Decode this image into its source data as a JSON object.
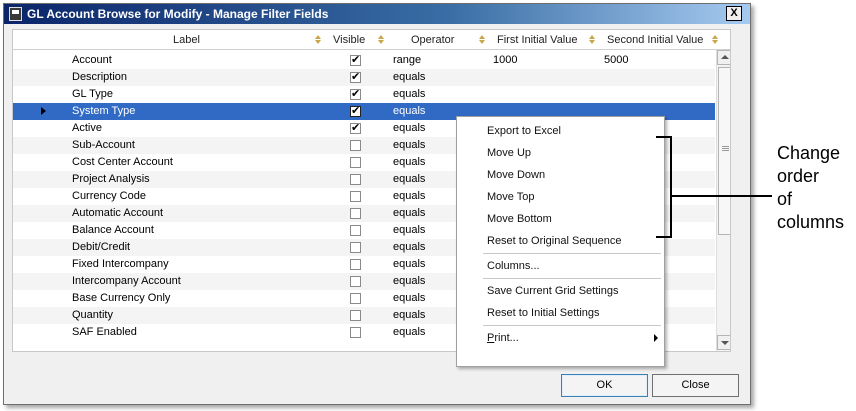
{
  "window": {
    "title": "GL Account Browse for Modify - Manage Filter Fields",
    "close_label": "X",
    "ok_label": "OK",
    "close_button_label": "Close"
  },
  "grid": {
    "columns": [
      "Label",
      "Visible",
      "Operator",
      "First Initial Value",
      "Second Initial Value"
    ],
    "rows": [
      {
        "label": "Account",
        "visible": true,
        "operator": "range",
        "first": "1000",
        "second": "5000"
      },
      {
        "label": "Description",
        "visible": true,
        "operator": "equals",
        "first": "",
        "second": ""
      },
      {
        "label": "GL Type",
        "visible": true,
        "operator": "equals",
        "first": "",
        "second": ""
      },
      {
        "label": "System Type",
        "visible": true,
        "operator": "equals",
        "first": "",
        "second": "",
        "selected": true
      },
      {
        "label": "Active",
        "visible": true,
        "operator": "equals",
        "first": "",
        "second": ""
      },
      {
        "label": "Sub-Account",
        "visible": false,
        "operator": "equals",
        "first": "",
        "second": ""
      },
      {
        "label": "Cost Center Account",
        "visible": false,
        "operator": "equals",
        "first": "",
        "second": ""
      },
      {
        "label": "Project Analysis",
        "visible": false,
        "operator": "equals",
        "first": "",
        "second": ""
      },
      {
        "label": "Currency Code",
        "visible": false,
        "operator": "equals",
        "first": "",
        "second": ""
      },
      {
        "label": "Automatic Account",
        "visible": false,
        "operator": "equals",
        "first": "",
        "second": ""
      },
      {
        "label": "Balance Account",
        "visible": false,
        "operator": "equals",
        "first": "",
        "second": ""
      },
      {
        "label": "Debit/Credit",
        "visible": false,
        "operator": "equals",
        "first": "",
        "second": ""
      },
      {
        "label": "Fixed Intercompany",
        "visible": false,
        "operator": "equals",
        "first": "",
        "second": ""
      },
      {
        "label": "Intercompany Account",
        "visible": false,
        "operator": "equals",
        "first": "",
        "second": ""
      },
      {
        "label": "Base Currency Only",
        "visible": false,
        "operator": "equals",
        "first": "",
        "second": ""
      },
      {
        "label": "Quantity",
        "visible": false,
        "operator": "equals",
        "first": "",
        "second": ""
      },
      {
        "label": "SAF Enabled",
        "visible": false,
        "operator": "equals",
        "first": "",
        "second": ""
      }
    ]
  },
  "context_menu": {
    "items": [
      {
        "label": "Export to Excel"
      },
      {
        "label": "Move Up"
      },
      {
        "label": "Move Down"
      },
      {
        "label": "Move Top"
      },
      {
        "label": "Move Bottom"
      },
      {
        "label": "Reset to Original Sequence"
      },
      {
        "separator": true
      },
      {
        "label": "Columns..."
      },
      {
        "separator": true
      },
      {
        "label": "Save Current Grid Settings"
      },
      {
        "label": "Reset to Initial Settings"
      },
      {
        "separator": true
      },
      {
        "label": "Print...",
        "mnemonic": "P",
        "rest": "rint...",
        "submenu": true
      }
    ]
  },
  "annotation": {
    "lines": [
      "Change",
      "order",
      "of",
      "columns"
    ]
  },
  "colors": {
    "selection": "#316ac5",
    "header_sort_icon": "#c9a64a"
  }
}
